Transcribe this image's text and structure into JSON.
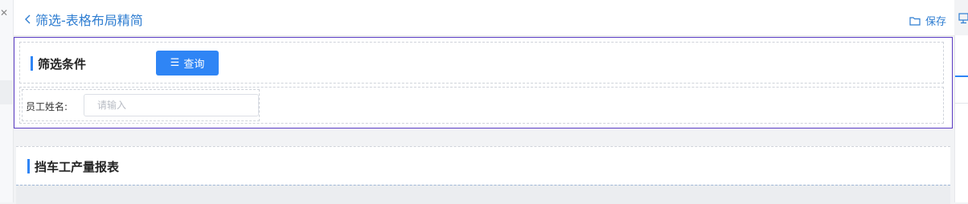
{
  "header": {
    "title": "筛选-表格布局精简",
    "save_label": "保存"
  },
  "filter": {
    "section_title": "筛选条件",
    "query_label": "查询",
    "fields": [
      {
        "label": "员工姓名:",
        "placeholder": "请输入",
        "value": ""
      }
    ]
  },
  "report": {
    "title": "挡车工产量报表"
  },
  "colors": {
    "accent": "#2f85f5",
    "link": "#2e7dd1",
    "selection_outline": "#5b3cc4"
  }
}
